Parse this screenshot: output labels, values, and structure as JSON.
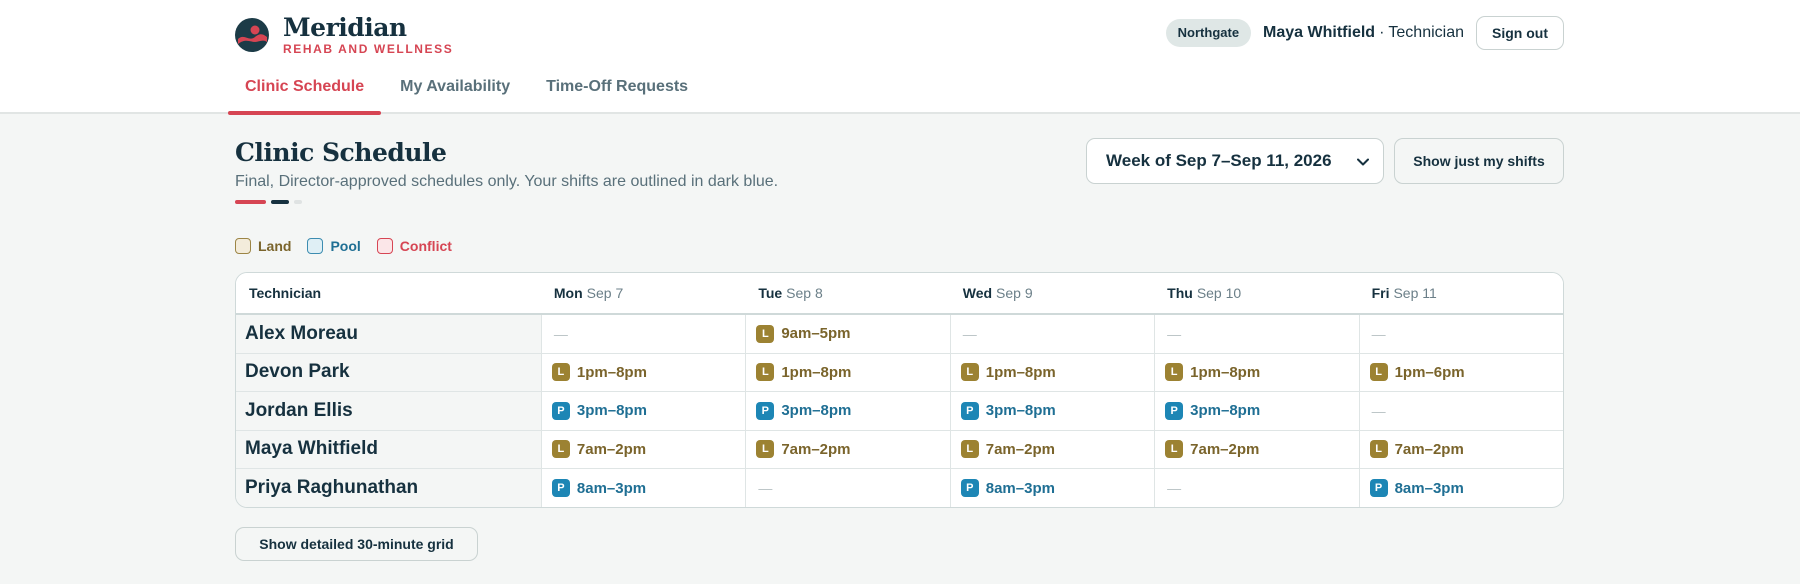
{
  "brand": {
    "name": "Meridian",
    "subtitle": "REHAB AND WELLNESS",
    "logo_icon": "wave-logo-icon"
  },
  "user": {
    "location": "Northgate",
    "name": "Maya Whitfield",
    "separator": "·",
    "role": "Technician",
    "sign_out_label": "Sign out"
  },
  "tabs": [
    {
      "label": "Clinic Schedule",
      "active": true
    },
    {
      "label": "My Availability",
      "active": false
    },
    {
      "label": "Time-Off Requests",
      "active": false
    }
  ],
  "page": {
    "title": "Clinic Schedule",
    "subtitle": "Final, Director-approved schedules only. Your shifts are outlined in dark blue.",
    "week_select_value": "Week of Sep 7–Sep 11, 2026",
    "my_shifts_label": "Show just my shifts",
    "grid_button_label": "Show detailed 30-minute grid"
  },
  "legend": [
    {
      "label": "Land",
      "color": "#9c8545"
    },
    {
      "label": "Pool",
      "color": "#3c8cb0"
    },
    {
      "label": "Conflict",
      "color": "#d64553"
    }
  ],
  "schedule": {
    "header": {
      "technician": "Technician",
      "days": [
        {
          "dow": "Mon",
          "date": "Sep 7"
        },
        {
          "dow": "Tue",
          "date": "Sep 8"
        },
        {
          "dow": "Wed",
          "date": "Sep 9"
        },
        {
          "dow": "Thu",
          "date": "Sep 10"
        },
        {
          "dow": "Fri",
          "date": "Sep 11"
        }
      ]
    },
    "empty_symbol": "—",
    "rows": [
      {
        "name": "Alex Moreau",
        "shifts": [
          null,
          {
            "type": "L",
            "time": "9am–5pm"
          },
          null,
          null,
          null
        ]
      },
      {
        "name": "Devon Park",
        "shifts": [
          {
            "type": "L",
            "time": "1pm–8pm"
          },
          {
            "type": "L",
            "time": "1pm–8pm"
          },
          {
            "type": "L",
            "time": "1pm–8pm"
          },
          {
            "type": "L",
            "time": "1pm–8pm"
          },
          {
            "type": "L",
            "time": "1pm–6pm"
          }
        ]
      },
      {
        "name": "Jordan Ellis",
        "shifts": [
          {
            "type": "P",
            "time": "3pm–8pm"
          },
          {
            "type": "P",
            "time": "3pm–8pm"
          },
          {
            "type": "P",
            "time": "3pm–8pm"
          },
          {
            "type": "P",
            "time": "3pm–8pm"
          },
          null
        ]
      },
      {
        "name": "Maya Whitfield",
        "shifts": [
          {
            "type": "L",
            "time": "7am–2pm"
          },
          {
            "type": "L",
            "time": "7am–2pm"
          },
          {
            "type": "L",
            "time": "7am–2pm"
          },
          {
            "type": "L",
            "time": "7am–2pm"
          },
          {
            "type": "L",
            "time": "7am–2pm"
          }
        ]
      },
      {
        "name": "Priya Raghunathan",
        "shifts": [
          {
            "type": "P",
            "time": "8am–3pm"
          },
          null,
          {
            "type": "P",
            "time": "8am–3pm"
          },
          null,
          {
            "type": "P",
            "time": "8am–3pm"
          }
        ]
      }
    ]
  }
}
